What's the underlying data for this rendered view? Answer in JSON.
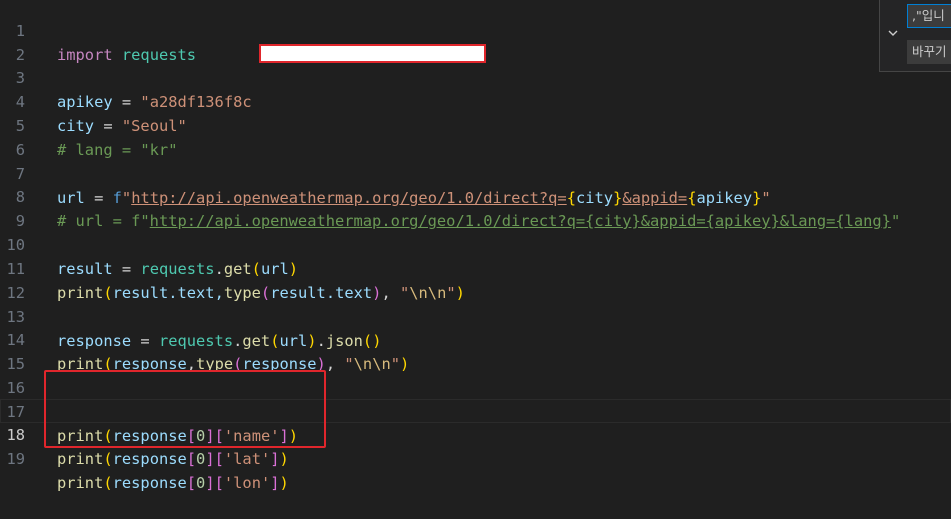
{
  "editor": {
    "line_numbers": [
      "1",
      "2",
      "3",
      "4",
      "5",
      "6",
      "7",
      "8",
      "9",
      "10",
      "11",
      "12",
      "13",
      "14",
      "15",
      "16",
      "17",
      "18",
      "19"
    ],
    "l1": {
      "kw": "import",
      "mod": "requests"
    },
    "l3": {
      "var": "apikey",
      "op": " = ",
      "str": "\"a28df136f8c"
    },
    "l4": {
      "var": "city",
      "op": " = ",
      "str": "\"Seoul\""
    },
    "l5": {
      "cmt": "# lang = \"kr\""
    },
    "l7": {
      "var": "url",
      "op": " = ",
      "fpre": "f",
      "q1": "\"",
      "url_a": "http://api.openweathermap.org/geo/1.0/direct?q=",
      "b1": "{",
      "i1": "city",
      "b2": "}",
      "url_b": "&appid=",
      "b3": "{",
      "i2": "apikey",
      "b4": "}",
      "q2": "\""
    },
    "l8": {
      "pre": "# url = f\"",
      "url": "http://api.openweathermap.org/geo/1.0/direct?q={city}&appid={apikey}&lang={lang}",
      "post": "\""
    },
    "l10": {
      "var": "result",
      "op": " = ",
      "mod": "requests",
      "dot": ".",
      "fn": "get",
      "p1": "(",
      "arg": "url",
      "p2": ")"
    },
    "l11": {
      "fn": "print",
      "p1": "(",
      "a1": "result",
      "a2": ".text,",
      "fn2": "type",
      "p2": "(",
      "a3": "result",
      "a4": ".text",
      "p3": ")",
      "comma": ", ",
      "str1": "\"",
      "esc": "\\n\\n",
      "str2": "\"",
      "p4": ")"
    },
    "l13": {
      "var": "response",
      "op": " = ",
      "mod": "requests",
      "dot": ".",
      "fn": "get",
      "p1": "(",
      "arg": "url",
      "p2": ")",
      "dot2": ".",
      "fn2": "json",
      "p3": "()"
    },
    "l14": {
      "fn": "print",
      "p1": "(",
      "a1": "response",
      "a2": ",",
      "fn2": "type",
      "p2": "(",
      "a3": "response",
      "p3": ")",
      "comma": ", ",
      "str1": "\"",
      "esc": "\\n\\n",
      "str2": "\"",
      "p4": ")"
    },
    "l17": {
      "fn": "print",
      "p1": "(",
      "a1": "response",
      "b1": "[",
      "n": "0",
      "b2": "]",
      "b3": "[",
      "s": "'name'",
      "b4": "]",
      "p2": ")"
    },
    "l18": {
      "fn": "print",
      "p1": "(",
      "a1": "response",
      "b1": "[",
      "n": "0",
      "b2": "]",
      "b3": "[",
      "s": "'lat'",
      "b4": "]",
      "p2": ")"
    },
    "l19": {
      "fn": "print",
      "p1": "(",
      "a1": "response",
      "b1": "[",
      "n": "0",
      "b2": "]",
      "b3": "[",
      "s": "'lon'",
      "b4": "]",
      "p2": ")"
    }
  },
  "find_widget": {
    "find_value": ",\"입니",
    "replace_value": "바꾸기"
  }
}
